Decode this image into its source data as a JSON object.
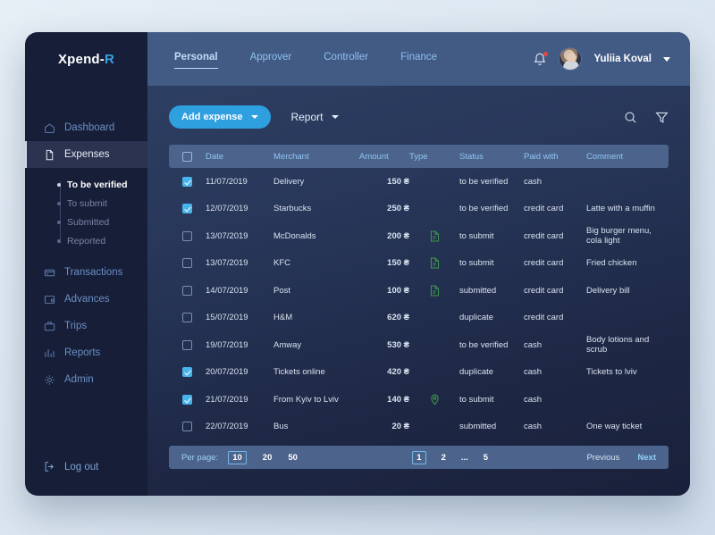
{
  "brand": {
    "text_main": "Xpend-",
    "text_accent": "R"
  },
  "sidebar": {
    "items": [
      {
        "label": "Dashboard",
        "icon": "home-icon"
      },
      {
        "label": "Expenses",
        "icon": "document-icon"
      },
      {
        "label": "Transactions",
        "icon": "card-icon"
      },
      {
        "label": "Advances",
        "icon": "wallet-icon"
      },
      {
        "label": "Trips",
        "icon": "briefcase-icon"
      },
      {
        "label": "Reports",
        "icon": "bar-chart-icon"
      },
      {
        "label": "Admin",
        "icon": "gear-icon"
      }
    ],
    "submenu": [
      {
        "label": "To be verified"
      },
      {
        "label": "To submit"
      },
      {
        "label": "Submitted"
      },
      {
        "label": "Reported"
      }
    ],
    "logout": {
      "label": "Log out",
      "icon": "logout-icon"
    }
  },
  "topbar": {
    "tabs": [
      {
        "label": "Personal"
      },
      {
        "label": "Approver"
      },
      {
        "label": "Controller"
      },
      {
        "label": "Finance"
      }
    ],
    "notification_icon": "bell-icon",
    "avatar_icon": "avatar",
    "username": "Yuliia Koval",
    "caret_icon": "chevron-down-icon"
  },
  "toolbar": {
    "add_expense_label": "Add expense",
    "report_label": "Report",
    "search_icon": "search-icon",
    "filter_icon": "filter-icon"
  },
  "table": {
    "headers": {
      "date": "Date",
      "merchant": "Merchant",
      "amount": "Amount",
      "type": "Type",
      "status": "Status",
      "paid_with": "Paid with",
      "comment": "Comment"
    },
    "rows": [
      {
        "checked": true,
        "date": "11/07/2019",
        "merchant": "Delivery",
        "amount": "150 ₴",
        "type": "",
        "status": "to be verified",
        "paid_with": "cash",
        "comment": ""
      },
      {
        "checked": true,
        "date": "12/07/2019",
        "merchant": "Starbucks",
        "amount": "250 ₴",
        "type": "",
        "status": "to be verified",
        "paid_with": "credit card",
        "comment": "Latte with a muffin"
      },
      {
        "checked": false,
        "date": "13/07/2019",
        "merchant": "McDonalds",
        "amount": "200 ₴",
        "type": "receipt",
        "status": "to submit",
        "paid_with": "credit card",
        "comment": "Big burger menu, cola light"
      },
      {
        "checked": false,
        "date": "13/07/2019",
        "merchant": "KFC",
        "amount": "150 ₴",
        "type": "receipt",
        "status": "to submit",
        "paid_with": "credit card",
        "comment": "Fried chicken"
      },
      {
        "checked": false,
        "date": "14/07/2019",
        "merchant": "Post",
        "amount": "100 ₴",
        "type": "receipt",
        "status": "submitted",
        "paid_with": "credit card",
        "comment": "Delivery bill"
      },
      {
        "checked": false,
        "date": "15/07/2019",
        "merchant": "H&M",
        "amount": "620 ₴",
        "type": "",
        "status": "duplicate",
        "paid_with": "credit card",
        "comment": ""
      },
      {
        "checked": false,
        "date": "19/07/2019",
        "merchant": "Amway",
        "amount": "530 ₴",
        "type": "",
        "status": "to be verified",
        "paid_with": "cash",
        "comment": "Body lotions and scrub"
      },
      {
        "checked": true,
        "date": "20/07/2019",
        "merchant": "Tickets online",
        "amount": "420 ₴",
        "type": "",
        "status": "duplicate",
        "paid_with": "cash",
        "comment": "Tickets to lviv"
      },
      {
        "checked": true,
        "date": "21/07/2019",
        "merchant": "From Kyiv to Lviv",
        "amount": "140 ₴",
        "type": "location",
        "status": "to submit",
        "paid_with": "cash",
        "comment": ""
      },
      {
        "checked": false,
        "date": "22/07/2019",
        "merchant": "Bus",
        "amount": "20 ₴",
        "type": "",
        "status": "submitted",
        "paid_with": "cash",
        "comment": "One way ticket"
      }
    ]
  },
  "pagination": {
    "per_page_label": "Per page:",
    "per_page_options": [
      "10",
      "20",
      "50"
    ],
    "per_page_selected": "10",
    "pages": [
      "1",
      "2",
      "...",
      "5"
    ],
    "current_page": "1",
    "previous_label": "Previous",
    "next_label": "Next"
  },
  "colors": {
    "accent_blue": "#2e9fdf",
    "sidebar_bg": "#161e38",
    "topbar_bg": "#425b85",
    "table_header_bg": "#4c648c",
    "type_icon_green": "#3f9a4a",
    "notification_dot": "#e8463f"
  }
}
